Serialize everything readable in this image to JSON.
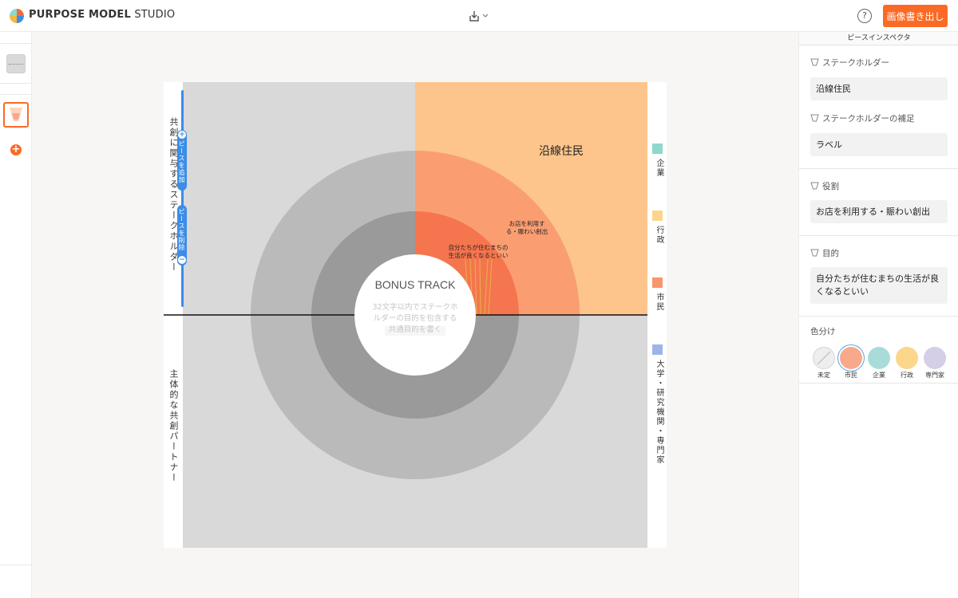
{
  "header": {
    "brand_bold": "PURPOSE MODEL",
    "brand_light": " STUDIO",
    "help_label": "?",
    "export_label": "画像書き出し"
  },
  "left_rail": {
    "add_label": "+"
  },
  "canvas": {
    "left_top_label": "共創に関与するステークホルダー",
    "left_bottom_label": "主体的な共創パートナー",
    "add_piece_label": "ピースを追加",
    "remove_piece_label": "ピースを削除",
    "add_cap": "+",
    "remove_cap": "−",
    "center_title": "BONUS TRACK",
    "center_hint": "32文字以内でステークホルダーの目的を包含する共通目的を書く",
    "stakeholder_label": "沿線住民",
    "role_label": "お店を利用する・賑わい創出",
    "purpose_label": "自分たちが住むまちの生活が良くなるといい",
    "legend": [
      {
        "label": "企業",
        "color": "#8dd9cc"
      },
      {
        "label": "行政",
        "color": "#fdd58a"
      },
      {
        "label": "市民",
        "color": "#f8966c"
      },
      {
        "label": "大学・研究機関・専門家",
        "color": "#9cb4e8"
      }
    ]
  },
  "inspector": {
    "title": "ピースインスペクタ",
    "stakeholder_label": "ステークホルダー",
    "stakeholder_value": "沿線住民",
    "supplement_label": "ステークホルダーの補足",
    "supplement_value": "ラベル",
    "role_label": "役割",
    "role_value": "お店を利用する・賑わい創出",
    "purpose_label": "目的",
    "purpose_value": "自分たちが住むまちの生活が良くなるといい",
    "color_section_label": "色分け",
    "swatches": [
      {
        "label": "未定",
        "color": "#eeeeee"
      },
      {
        "label": "市民",
        "color": "#f8a98a"
      },
      {
        "label": "企業",
        "color": "#a9dcd8"
      },
      {
        "label": "行政",
        "color": "#fcd68a"
      },
      {
        "label": "専門家",
        "color": "#d4cee6"
      }
    ],
    "selected_swatch": "市民"
  }
}
